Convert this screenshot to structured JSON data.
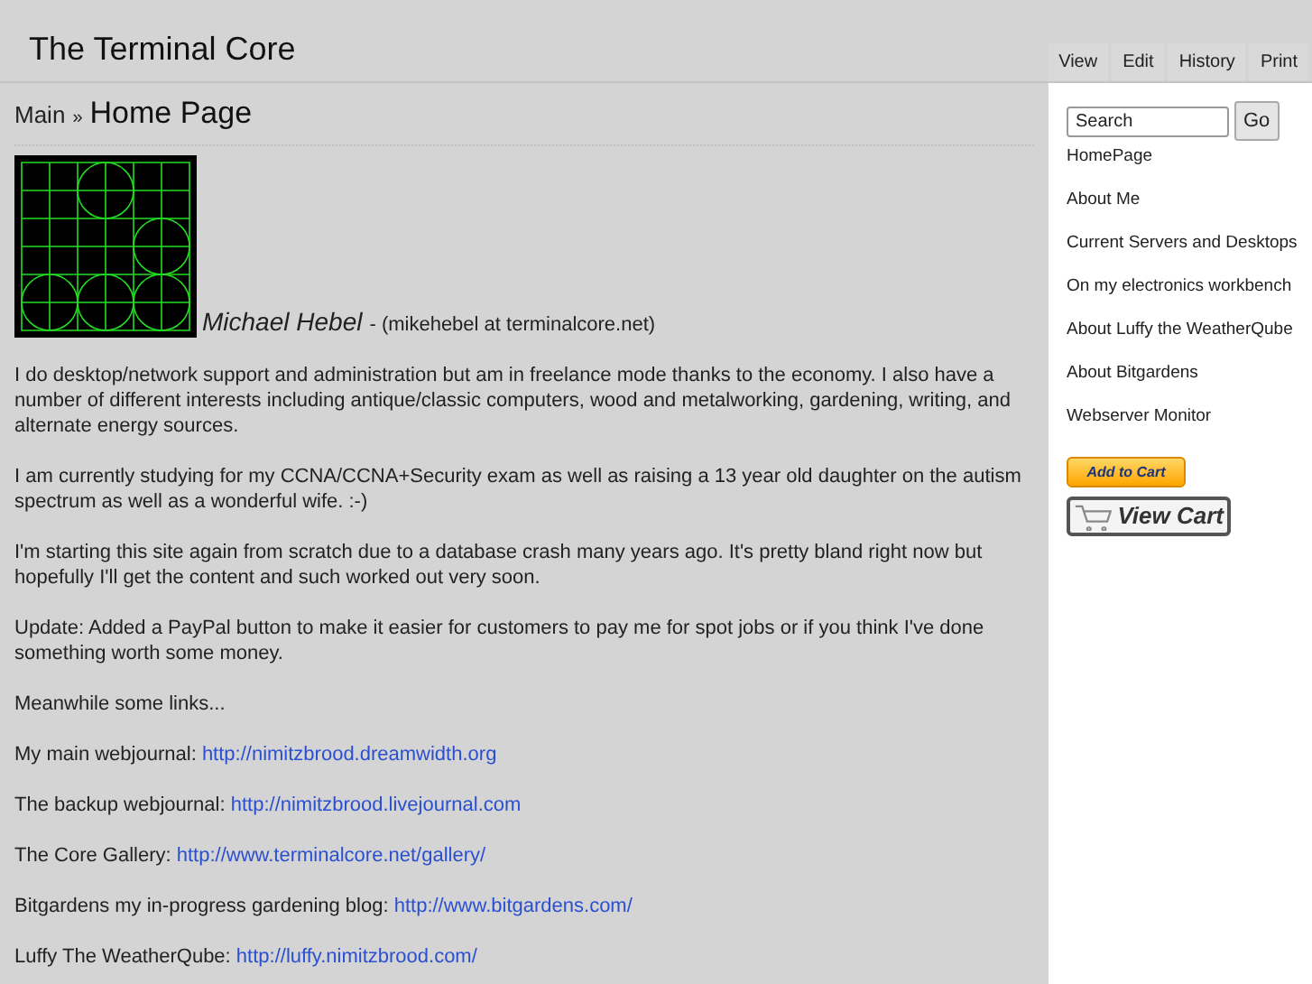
{
  "site_title": "The Terminal Core",
  "tabs": [
    "View",
    "Edit",
    "History",
    "Print"
  ],
  "breadcrumb": {
    "parent": "Main",
    "separator": "»",
    "title": "Home Page"
  },
  "author": {
    "name": "Michael Hebel",
    "contact": "- (mikehebel at terminalcore.net)"
  },
  "paragraphs": [
    {
      "kind": "text",
      "text": "I do desktop/network support and administration but am in freelance mode thanks to the economy. I also have a number of different interests including antique/classic computers, wood and metalworking, gardening, writing, and alternate energy sources."
    },
    {
      "kind": "text",
      "text": "I am currently studying for my CCNA/CCNA+Security exam as well as raising a 13 year old daughter on the autism spectrum as well as a wonderful wife. :-)"
    },
    {
      "kind": "text",
      "text": "I'm starting this site again from scratch due to a database crash many years ago. It's pretty bland right now but hopefully I'll get the content and such worked out very soon."
    },
    {
      "kind": "text",
      "text": "Update: Added a PayPal button to make it easier for customers to pay me for spot jobs or if you think I've done something worth some money."
    },
    {
      "kind": "text",
      "text": "Meanwhile some links..."
    },
    {
      "kind": "link",
      "text": "My main webjournal:",
      "url": "http://nimitzbrood.dreamwidth.org"
    },
    {
      "kind": "link",
      "text": "The backup webjournal:",
      "url": "http://nimitzbrood.livejournal.com"
    },
    {
      "kind": "link",
      "text": "The Core Gallery:",
      "url": "http://www.terminalcore.net/gallery/"
    },
    {
      "kind": "link",
      "text": "Bitgardens my in-progress gardening blog:",
      "url": "http://www.bitgardens.com/"
    },
    {
      "kind": "link",
      "text": "Luffy The WeatherQube:",
      "url": "http://luffy.nimitzbrood.com/"
    }
  ],
  "sidebar": {
    "search": {
      "value": "Search"
    },
    "go_button": "Go",
    "items": [
      "HomePage",
      "About Me",
      "Current Servers and Desktops",
      "On my electronics workbench",
      "About Luffy the WeatherQube",
      "About Bitgardens",
      "Webserver Monitor"
    ],
    "add_to_cart": "Add to Cart",
    "view_cart": "View Cart"
  }
}
